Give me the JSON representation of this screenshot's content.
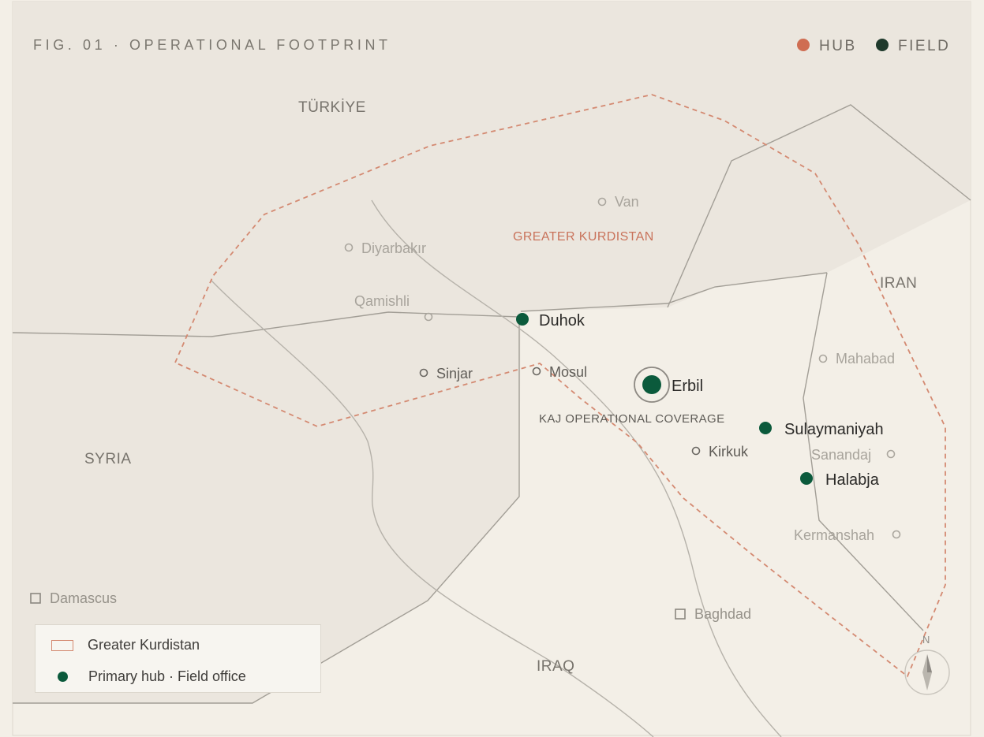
{
  "figure_title": "FIG. 01 · OPERATIONAL FOOTPRINT",
  "top_legend": [
    {
      "label": "HUB",
      "color": "#cf6d52"
    },
    {
      "label": "FIELD",
      "color": "#1f3a2c"
    }
  ],
  "countries": {
    "turkiye": "TÜRKİYE",
    "iran": "IRAN",
    "syria": "SYRIA",
    "iraq": "IRAQ"
  },
  "region_label": "GREATER KURDISTAN",
  "coverage_label": "KAJ OPERATIONAL COVERAGE",
  "cities": {
    "van": "Van",
    "diyarbakir": "Diyarbakır",
    "qamishli": "Qamishli",
    "mahabad": "Mahabad",
    "sanandaj": "Sanandaj",
    "kermanshah": "Kermanshah",
    "sinjar": "Sinjar",
    "mosul": "Mosul",
    "kirkuk": "Kirkuk",
    "damascus": "Damascus",
    "baghdad": "Baghdad"
  },
  "offices": {
    "erbil": "Erbil",
    "duhok": "Duhok",
    "sulaymaniyah": "Sulaymaniyah",
    "halabja": "Halabja"
  },
  "legend_box": {
    "kurdistan": "Greater Kurdistan",
    "hub": "Primary hub · Field office"
  },
  "compass": "N",
  "colors": {
    "background": "#f3efe7",
    "land_shaded": "#ebe6de",
    "border": "#9a968e",
    "kurdistan_outline": "#d48a72",
    "hub_green": "#0b5a3c",
    "region_text": "#c9735b"
  }
}
